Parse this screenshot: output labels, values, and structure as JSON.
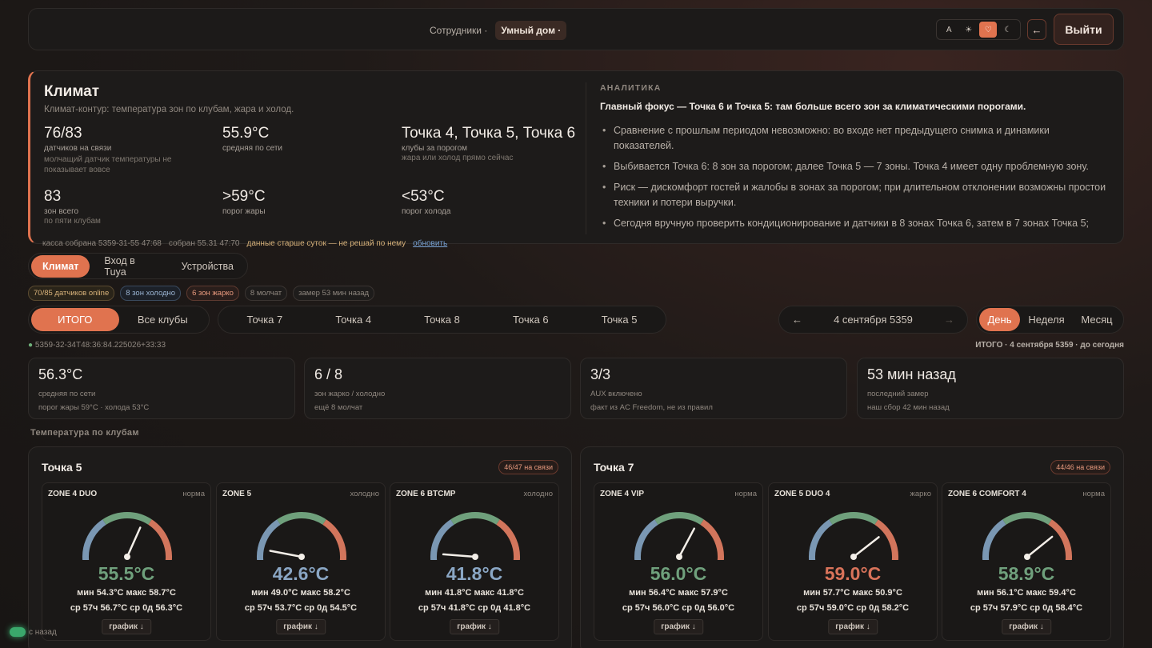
{
  "nav": {
    "items": [
      {
        "label": "Сотрудники ·",
        "active": false
      },
      {
        "label": "Умный дом ·",
        "active": true
      }
    ],
    "theme": [
      "A",
      "☀",
      "♡",
      "☾"
    ],
    "back_icon": "arrow-left-icon",
    "logout_label": "Выйти"
  },
  "climate": {
    "title": "Климат",
    "subtitle": "Климат-контур: температура зон по клубам, жара и холод.",
    "stats": [
      {
        "big": "76/83",
        "l1": "датчиков на связи",
        "l2": "молчащий датчик температуры не показывает вовсе"
      },
      {
        "big": "55.9°C",
        "l1": "средняя по сети",
        "l2": ""
      },
      {
        "big": "Точка 4, Точка 5, Точка 6",
        "l1": "клубы за порогом",
        "l2": "жара или холод прямо сейчас"
      },
      {
        "big": "83",
        "l1": "зон всего",
        "l2": "по пяти клубам"
      },
      {
        "big": ">59°C",
        "l1": "порог жары",
        "l2": ""
      },
      {
        "big": "<53°C",
        "l1": "порог холода",
        "l2": ""
      }
    ],
    "footer": {
      "kassa": "касса собрана 5359-31-55 47:68",
      "collected": "собран 55.31 47:70",
      "warning": "данные старше суток — не решай по нему",
      "refresh": "обновить"
    },
    "analytics": {
      "heading": "АНАЛИТИКА",
      "focus": "Главный фокус — Точка 6 и Точка 5: там больше всего зон за климатическими порогами.",
      "bullets": [
        "Сравнение с прошлым периодом невозможно: во входе нет предыдущего снимка и динамики показателей.",
        "Выбивается Точка 6: 8 зон за порогом; далее Точка 5 — 7 зоны. Точка 4 имеет одну проблемную зону.",
        "Риск — дискомфорт гостей и жалобы в зонах за порогом; при длительном отклонении возможны простои техники и потери выручки.",
        "Сегодня вручную проверить кондиционирование и датчики в 8 зонах Точка 6, затем в 7 зонах Точка 5;"
      ]
    }
  },
  "tabs": [
    {
      "label": "Климат",
      "active": true
    },
    {
      "label": "Вход в Tuya",
      "active": false
    },
    {
      "label": "Устройства",
      "active": false
    }
  ],
  "chips": {
    "online": "70/85 датчиков online",
    "cold": "8 зон холодно",
    "hot": "6 зон жарко",
    "silent": "8 молчат",
    "measured": "замер 53 мин назад"
  },
  "scope": {
    "total": "ИТОГО",
    "all": "Все клубы"
  },
  "clubs_filter": [
    "Точка 7",
    "Точка 4",
    "Точка 8",
    "Точка 6",
    "Точка 5"
  ],
  "date_nav": {
    "prev": "←",
    "date": "4 сентября 5359",
    "next": "→"
  },
  "periods": [
    {
      "label": "День",
      "active": true
    },
    {
      "label": "Неделя",
      "active": false
    },
    {
      "label": "Месяц",
      "active": false
    }
  ],
  "timestamp_left": "5359-32-34T48:36:84.225026+33:33",
  "timestamp_right": "ИТОГО · 4 сентября 5359 · до сегодня",
  "kpis": [
    {
      "val": "56.3°C",
      "l1": "средняя по сети",
      "l2": "порог жары 59°C · холода 53°C"
    },
    {
      "val": "6 / 8",
      "l1": "зон жарко / холодно",
      "l2": "ещё 8 молчат"
    },
    {
      "val": "3/3",
      "l1": "AUX включено",
      "l2": "факт из AC Freedom, не из правил"
    },
    {
      "val": "53 мин назад",
      "l1": "последний замер",
      "l2": "наш сбор 42 мин назад"
    }
  ],
  "section_title": "Температура по клубам",
  "clubs": [
    {
      "name": "Точка 5",
      "badge": "46/47 на связи",
      "zones": [
        {
          "name": "ZONE 4 DUO",
          "state": "норма",
          "temp": "55.5°C",
          "value": 55.5,
          "kind": "norm",
          "mm": "мин 54.3°C  макс 58.7°C",
          "avg": "ср 57ч 56.7°C  ср 0д 56.3°C",
          "btn": "график ↓"
        },
        {
          "name": "ZONE 5",
          "state": "холодно",
          "temp": "42.6°C",
          "value": 42.6,
          "kind": "cold",
          "mm": "мин 49.0°C  макс 58.2°C",
          "avg": "ср 57ч 53.7°C  ср 0д 54.5°C",
          "btn": "график ↓"
        },
        {
          "name": "ZONE 6 BTCMP",
          "state": "холодно",
          "temp": "41.8°C",
          "value": 41.8,
          "kind": "cold",
          "mm": "мин 41.8°C  макс 41.8°C",
          "avg": "ср 57ч 41.8°C  ср 0д 41.8°C",
          "btn": "график ↓"
        }
      ]
    },
    {
      "name": "Точка 7",
      "badge": "44/46 на связи",
      "zones": [
        {
          "name": "ZONE 4 VIP",
          "state": "норма",
          "temp": "56.0°C",
          "value": 56.0,
          "kind": "norm",
          "mm": "мин 56.4°C  макс 57.9°C",
          "avg": "ср 57ч 56.0°C  ср 0д 56.0°C",
          "btn": "график ↓"
        },
        {
          "name": "ZONE 5 DUO 4",
          "state": "жарко",
          "temp": "59.0°C",
          "value": 59.0,
          "kind": "hot",
          "mm": "мин 57.7°C  макс 50.9°C",
          "avg": "ср 57ч 59.0°C  ср 0д 58.2°C",
          "btn": "график ↓"
        },
        {
          "name": "ZONE 6 COMFORT 4",
          "state": "норма",
          "temp": "58.9°C",
          "value": 58.9,
          "kind": "norm",
          "mm": "мин 56.1°C  макс 59.4°C",
          "avg": "ср 57ч 57.9°C  ср 0д 58.4°C",
          "btn": "график ↓"
        }
      ]
    }
  ],
  "toast": "с назад",
  "colors": {
    "accent": "#e0734f",
    "norm": "#6fa07c",
    "cold": "#8aa6c4",
    "hot": "#d9735a"
  }
}
